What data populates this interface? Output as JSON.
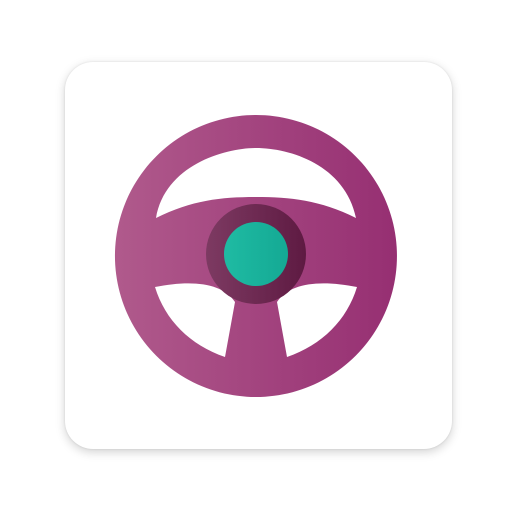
{
  "icon": {
    "name": "steering-wheel-icon",
    "colors": {
      "tile_background": "#ffffff",
      "wheel_gradient_start": "#b05a8c",
      "wheel_gradient_end": "#962f72",
      "hub_ring_start": "#7d3a62",
      "hub_ring_end": "#5e1a42",
      "hub_center_start": "#1fbba3",
      "hub_center_end": "#14a994"
    }
  }
}
